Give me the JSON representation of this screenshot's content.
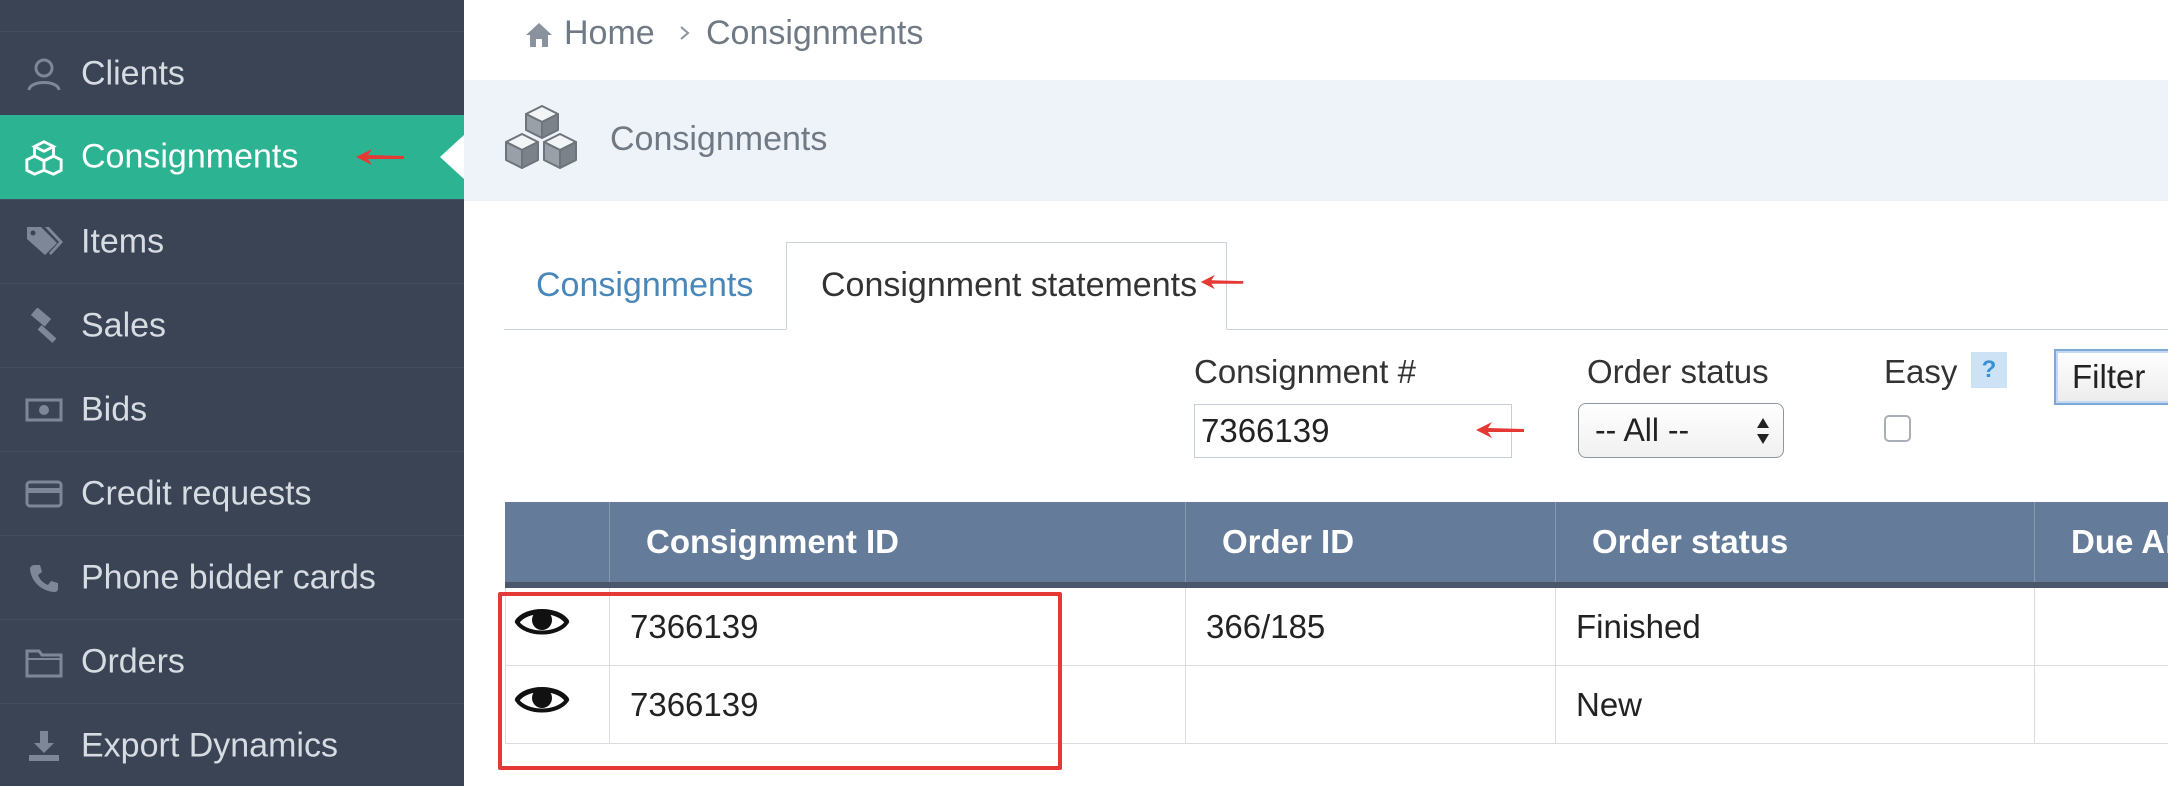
{
  "sidebar": {
    "items": [
      {
        "label": "Clients",
        "icon": "user-icon"
      },
      {
        "label": "Consignments",
        "icon": "cubes-icon",
        "active": true
      },
      {
        "label": "Items",
        "icon": "tags-icon"
      },
      {
        "label": "Sales",
        "icon": "gavel-icon"
      },
      {
        "label": "Bids",
        "icon": "money-icon"
      },
      {
        "label": "Credit requests",
        "icon": "credit-card-icon"
      },
      {
        "label": "Phone bidder cards",
        "icon": "phone-icon"
      },
      {
        "label": "Orders",
        "icon": "folder-icon"
      },
      {
        "label": "Export Dynamics",
        "icon": "download-icon"
      }
    ]
  },
  "breadcrumb": {
    "home": "Home",
    "current": "Consignments"
  },
  "page_header": {
    "title": "Consignments"
  },
  "tabs": [
    {
      "label": "Consignments",
      "active": false
    },
    {
      "label": "Consignment statements",
      "active": true
    }
  ],
  "filters": {
    "consignment_label": "Consignment #",
    "consignment_value": "7366139",
    "order_status_label": "Order status",
    "order_status_value": "-- All --",
    "easy_label": "Easy",
    "help": "?",
    "filter_button": "Filter"
  },
  "table": {
    "columns": [
      "",
      "Consignment ID",
      "Order ID",
      "Order status",
      "Due Ar"
    ],
    "rows": [
      {
        "consignment_id": "7366139",
        "order_id": "366/185",
        "order_status": "Finished",
        "due": ""
      },
      {
        "consignment_id": "7366139",
        "order_id": "",
        "order_status": "New",
        "due": ""
      }
    ]
  },
  "colors": {
    "sidebar_bg": "#3a4455",
    "sidebar_active": "#2cb492",
    "table_header": "#647b99",
    "annotation": "#e53935",
    "link": "#4a87b9"
  }
}
